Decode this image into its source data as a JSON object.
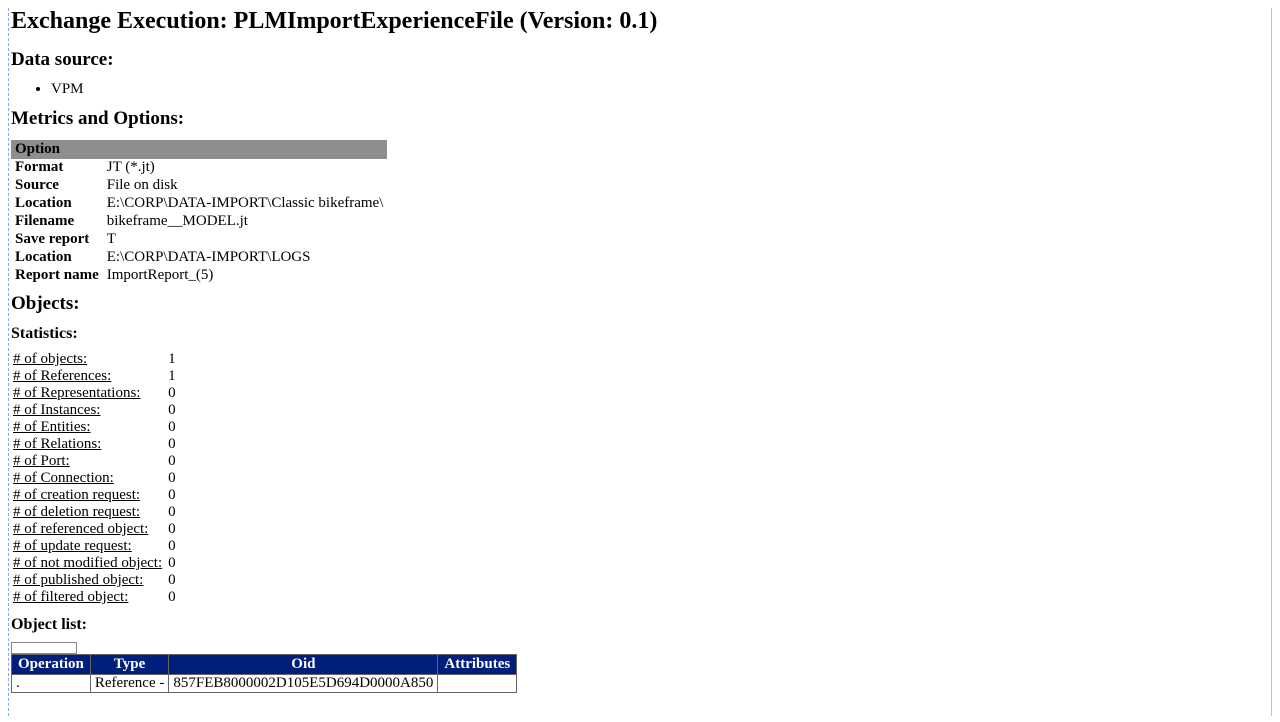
{
  "header": {
    "title": "Exchange Execution: PLMImportExperienceFile (Version: 0.1)"
  },
  "dataSource": {
    "heading": "Data source:",
    "items": [
      "VPM"
    ]
  },
  "metrics": {
    "heading": "Metrics and Options:",
    "optionHeader": "Option",
    "rows": [
      {
        "label": "Format",
        "value": "JT (*.jt)"
      },
      {
        "label": "Source",
        "value": "File on disk"
      },
      {
        "label": "Location",
        "value": "E:\\CORP\\DATA-IMPORT\\Classic bikeframe\\"
      },
      {
        "label": "Filename",
        "value": "bikeframe__MODEL.jt"
      },
      {
        "label": "Save report",
        "value": "T"
      },
      {
        "label": "Location",
        "value": "E:\\CORP\\DATA-IMPORT\\LOGS"
      },
      {
        "label": "Report name",
        "value": "ImportReport_(5)"
      }
    ]
  },
  "objects": {
    "heading": "Objects:"
  },
  "statistics": {
    "heading": "Statistics:",
    "rows": [
      {
        "label": "# of objects:",
        "value": "1"
      },
      {
        "label": "# of References:",
        "value": "1"
      },
      {
        "label": "# of Representations:",
        "value": "0"
      },
      {
        "label": "# of Instances:",
        "value": "0"
      },
      {
        "label": "# of Entities:",
        "value": "0"
      },
      {
        "label": "# of Relations:",
        "value": "0"
      },
      {
        "label": "# of Port:",
        "value": "0"
      },
      {
        "label": "# of Connection:",
        "value": "0"
      },
      {
        "label": "# of creation request:",
        "value": "0"
      },
      {
        "label": "# of deletion request:",
        "value": "0"
      },
      {
        "label": "# of referenced object:",
        "value": "0"
      },
      {
        "label": "# of update request:",
        "value": "0"
      },
      {
        "label": "# of not modified object:",
        "value": "0"
      },
      {
        "label": "# of published object:",
        "value": "0"
      },
      {
        "label": "# of filtered object:",
        "value": "0"
      }
    ]
  },
  "objectList": {
    "heading": "Object list:",
    "headers": [
      "Operation",
      "Type",
      "Oid",
      "Attributes"
    ],
    "rows": [
      {
        "operation": ".",
        "type": "Reference -",
        "oid": "857FEB8000002D105E5D694D0000A850",
        "attributes": ""
      }
    ]
  }
}
